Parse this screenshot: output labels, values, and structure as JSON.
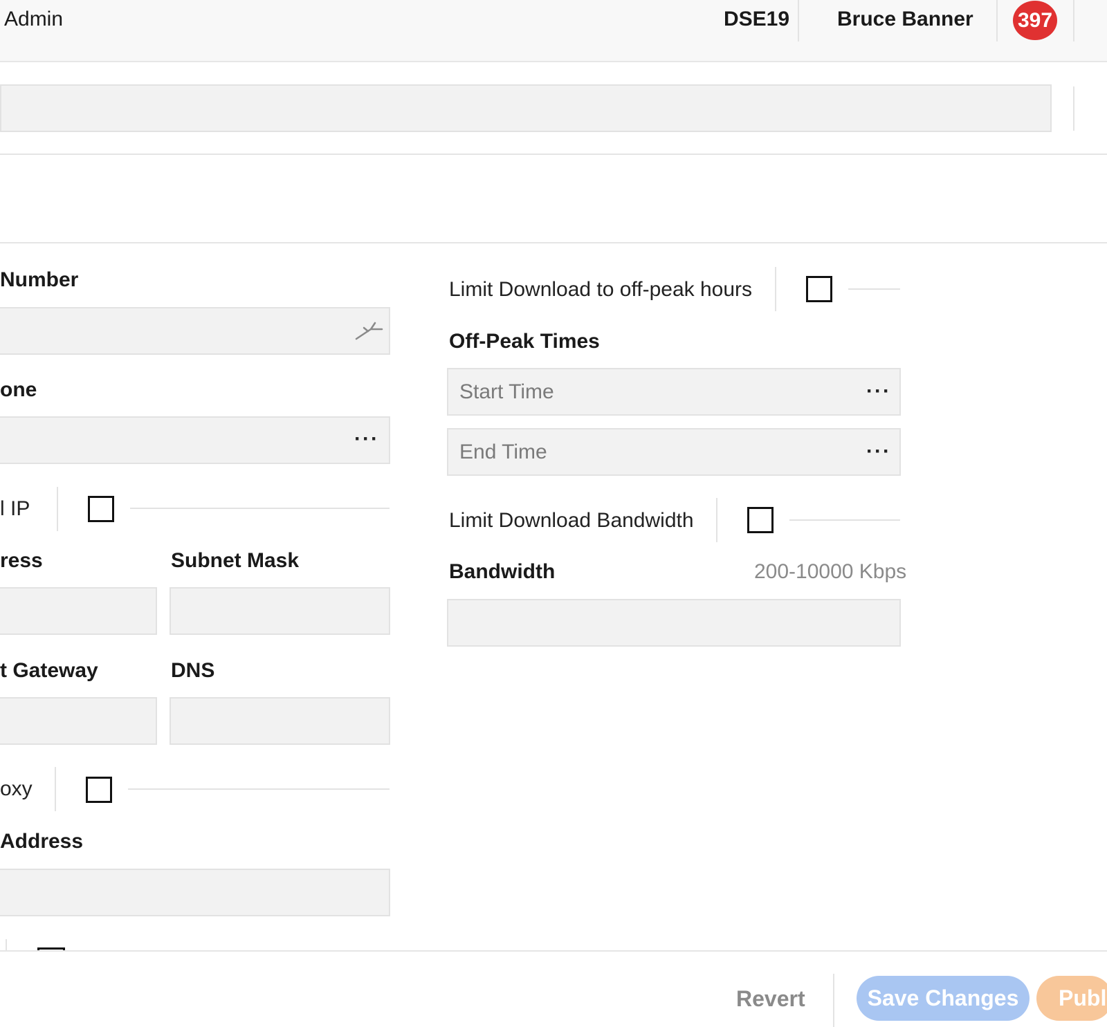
{
  "header": {
    "title": "Admin",
    "site_code": "DSE19",
    "user_name": "Bruce Banner",
    "notification_count": "397"
  },
  "search": {
    "value": ""
  },
  "left_form": {
    "number_label": "Number",
    "zone_label": "one",
    "static_ip_label": "l IP",
    "ip_address_label": "ress",
    "subnet_mask_label": "Subnet Mask",
    "gateway_label": "t Gateway",
    "dns_label": "DNS",
    "proxy_label": "oxy",
    "proxy_address_label": "Address"
  },
  "right_form": {
    "limit_offpeak_label": "Limit Download to off-peak hours",
    "offpeak_times_label": "Off-Peak Times",
    "start_time_placeholder": "Start Time",
    "end_time_placeholder": "End Time",
    "limit_bandwidth_label": "Limit Download Bandwidth",
    "bandwidth_label": "Bandwidth",
    "bandwidth_hint": "200-10000 Kbps"
  },
  "footer": {
    "revert_label": "Revert",
    "save_label": "Save Changes",
    "publish_label": "Publis",
    "save_color": "#a9c6f2",
    "publish_color": "#f8c79a"
  }
}
